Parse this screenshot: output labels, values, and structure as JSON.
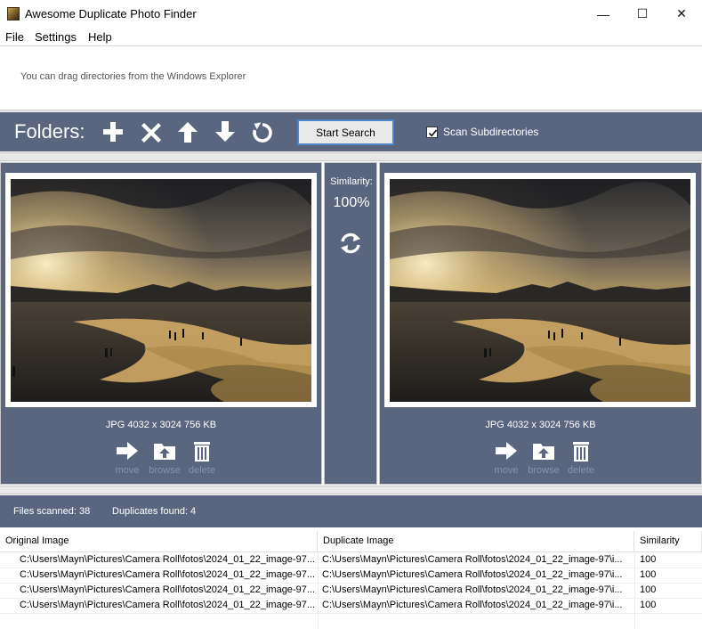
{
  "window": {
    "title": "Awesome Duplicate Photo Finder",
    "controls": {
      "minimize": "—",
      "maximize": "☐",
      "close": "✕"
    }
  },
  "menu": {
    "items": [
      "File",
      "Settings",
      "Help"
    ]
  },
  "hint": "You can drag directories from the Windows Explorer",
  "toolbar": {
    "folders_label": "Folders:",
    "icons": [
      "add-icon",
      "remove-icon",
      "move-up-icon",
      "move-down-icon",
      "reset-icon"
    ],
    "start_search": "Start Search",
    "scan_subdirectories": {
      "label": "Scan Subdirectories",
      "checked": true
    }
  },
  "compare": {
    "left": {
      "info": "JPG  4032 x 3024  756 KB"
    },
    "right": {
      "info": "JPG  4032 x 3024  756 KB"
    },
    "similarity_label": "Similarity:",
    "similarity_value": "100%",
    "actions": [
      "move",
      "browse",
      "delete"
    ]
  },
  "status": {
    "files_scanned": "Files scanned: 38",
    "duplicates_found": "Duplicates found: 4"
  },
  "table": {
    "headers": [
      "Original Image",
      "Duplicate Image",
      "Similarity"
    ],
    "rows": [
      [
        "C:\\Users\\Mayn\\Pictures\\Camera Roll\\fotos\\2024_01_22_image-97...",
        "C:\\Users\\Mayn\\Pictures\\Camera Roll\\fotos\\2024_01_22_image-97\\i...",
        "100"
      ],
      [
        "C:\\Users\\Mayn\\Pictures\\Camera Roll\\fotos\\2024_01_22_image-97...",
        "C:\\Users\\Mayn\\Pictures\\Camera Roll\\fotos\\2024_01_22_image-97\\i...",
        "100"
      ],
      [
        "C:\\Users\\Mayn\\Pictures\\Camera Roll\\fotos\\2024_01_22_image-97...",
        "C:\\Users\\Mayn\\Pictures\\Camera Roll\\fotos\\2024_01_22_image-97\\i...",
        "100"
      ],
      [
        "C:\\Users\\Mayn\\Pictures\\Camera Roll\\fotos\\2024_01_22_image-97...",
        "C:\\Users\\Mayn\\Pictures\\Camera Roll\\fotos\\2024_01_22_image-97\\i...",
        "100"
      ]
    ]
  },
  "colors": {
    "panel_bg": "#5a6580",
    "accent_border": "#4f86c7",
    "action_label": "#8b93a7"
  }
}
